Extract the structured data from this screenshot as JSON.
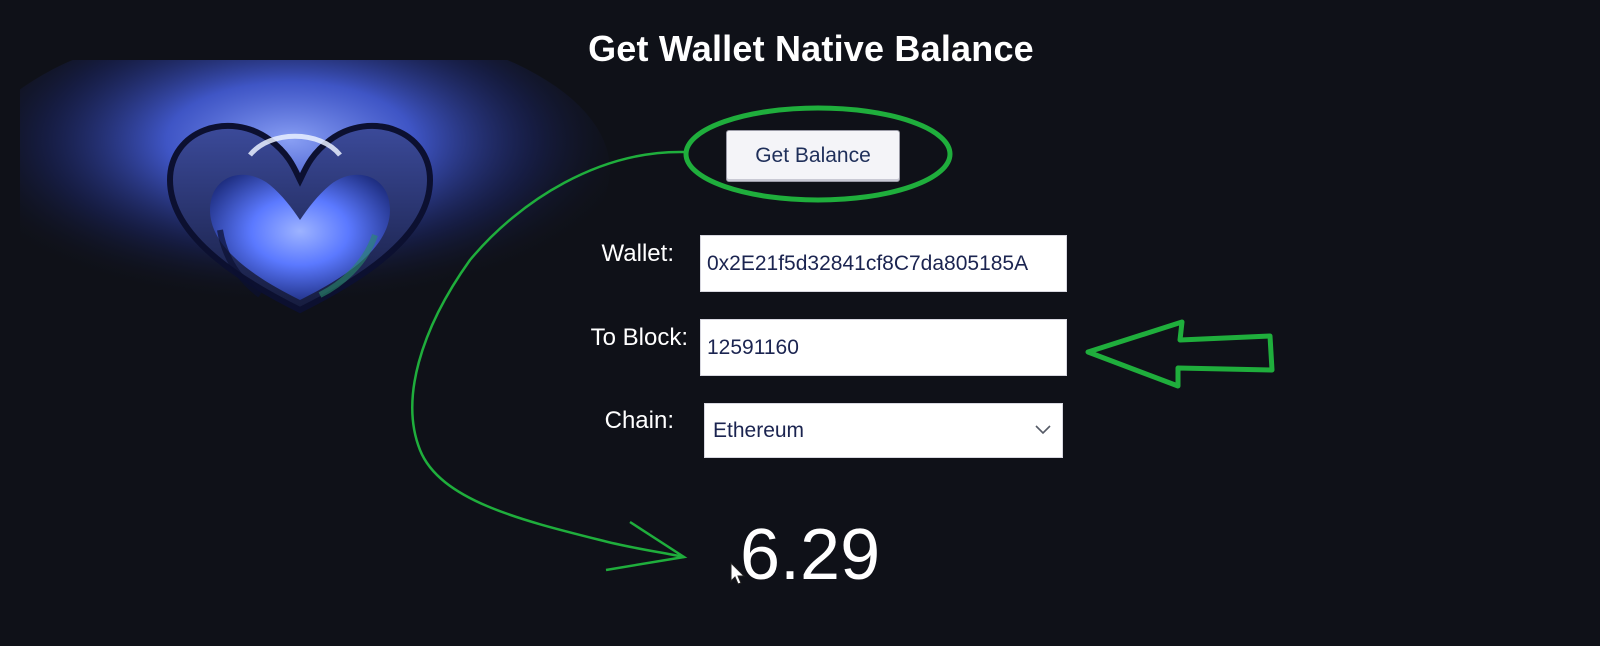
{
  "page": {
    "title": "Get Wallet Native Balance"
  },
  "logo": {
    "icon": "heart-m-logo-icon"
  },
  "form": {
    "button_label": "Get Balance",
    "wallet_label": "Wallet:",
    "wallet_value": "0x2E21f5d32841cf8C7da805185A",
    "block_label": "To Block:",
    "block_value": "12591160",
    "chain_label": "Chain:",
    "chain_value": "Ethereum"
  },
  "result": {
    "balance": "6.29"
  },
  "colors": {
    "background": "#0f1118",
    "annotation": "#1fae3c",
    "logo_glow": "#4f6cff"
  }
}
